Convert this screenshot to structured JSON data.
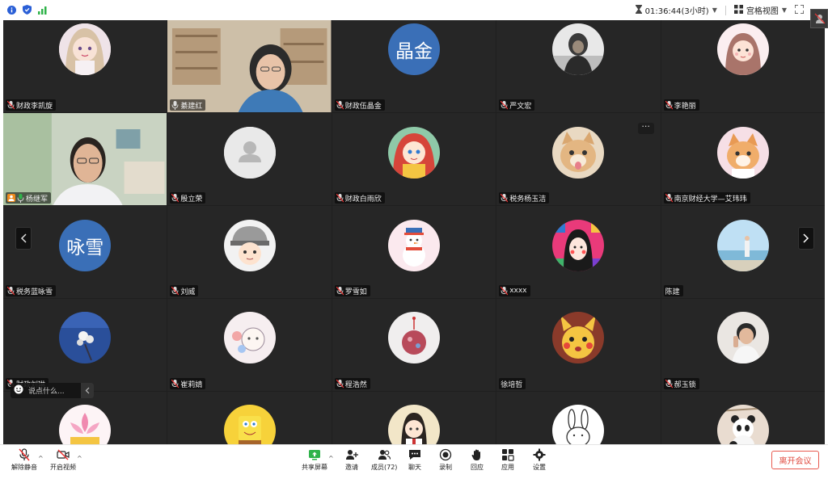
{
  "topbar": {
    "timer": "01:36:44(3小时)",
    "view_mode": "宫格视图"
  },
  "tiles": [
    {
      "name": "财政李凯旋",
      "avatar": "anime-girl-avatar"
    },
    {
      "name": "綦建红",
      "avatar": "video-feed"
    },
    {
      "name": "财政伍晶金",
      "avatar_text": "晶金"
    },
    {
      "name": "严文宏",
      "avatar": "hooded-figure-avatar"
    },
    {
      "name": "李艳丽",
      "avatar": "cartoon-girl-avatar"
    },
    {
      "name": "杨继军",
      "avatar": "video-feed"
    },
    {
      "name": "殷立荣",
      "avatar": "default-user-icon"
    },
    {
      "name": "财政白雨欣",
      "avatar": "anime-redhair-avatar"
    },
    {
      "name": "税务杨玉洁",
      "avatar": "cat-avatar"
    },
    {
      "name": "南京财经大学—艾玮玮",
      "avatar": "kitten-avatar"
    },
    {
      "name": "税务蓝咏雪",
      "avatar_text": "咏雪"
    },
    {
      "name": "刘威",
      "avatar": "cartoon-cap-avatar"
    },
    {
      "name": "罗雪如",
      "avatar": "snowman-avatar"
    },
    {
      "name": "xxxx",
      "avatar": "colorful-face-avatar"
    },
    {
      "name": "陈建",
      "avatar": "sky-photo-avatar"
    },
    {
      "name": "财政刘琳",
      "avatar": "flower-wall-avatar"
    },
    {
      "name": "崔莉婧",
      "avatar": "sketch-avatar"
    },
    {
      "name": "程浩然",
      "avatar": "globe-avatar"
    },
    {
      "name": "徐培哲",
      "avatar": "pikachu-avatar"
    },
    {
      "name": "郝玉锁",
      "avatar": "selfie-avatar"
    },
    {
      "name": "",
      "avatar": "lotus-avatar"
    },
    {
      "name": "",
      "avatar": "spongebob-avatar"
    },
    {
      "name": "",
      "avatar": "anime-school-avatar"
    },
    {
      "name": "",
      "avatar": "bunny-sketch-avatar"
    },
    {
      "name": "",
      "avatar": "panda-avatar"
    }
  ],
  "chat": {
    "placeholder": "说点什么..."
  },
  "toolbar": {
    "mute": "解除静音",
    "video": "开启视频",
    "share": "共享屏幕",
    "invite": "邀请",
    "members": "成员(72)",
    "chat": "聊天",
    "record": "录制",
    "interact": "回应",
    "apps": "应用",
    "settings": "设置",
    "leave": "离开会议"
  },
  "colors": {
    "accent_green": "#2fb34a",
    "leave_red": "#e04a3f",
    "text_avatar_blue": "#3a6fb7"
  }
}
